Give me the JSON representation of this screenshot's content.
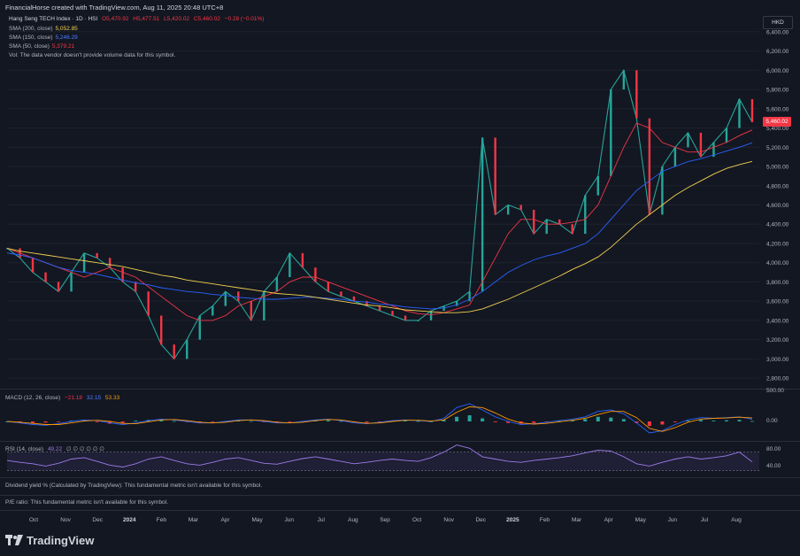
{
  "header": {
    "attribution": "FinancialHorse created with TradingView.com, Aug 11, 2025 20:48 UTC+8"
  },
  "legend": {
    "symbol": "Hang Seng TECH Index · 1D · HSI",
    "ohlc": {
      "o": "O5,470.92",
      "h": "H5,477.51",
      "l": "L5,420.02",
      "c": "C5,460.02",
      "chg": "−0.28 (−0.01%)"
    },
    "sma200": {
      "label": "SMA (200, close)",
      "value": "5,052.85",
      "color": "#f0d050"
    },
    "sma150": {
      "label": "SMA (150, close)",
      "value": "5,246.29",
      "color": "#2962ff"
    },
    "sma50": {
      "label": "SMA (50, close)",
      "value": "5,379.21",
      "color": "#f23645"
    },
    "vol": "Vol: The data vendor doesn't provide volume data for this symbol."
  },
  "currency_button": "HKD",
  "last_price_tag": "5,460.02",
  "macd_panel": {
    "label": "MACD (12, 26, close)",
    "v1": "−21.18",
    "v2": "32.15",
    "v3": "53.33",
    "axis": [
      "500.00",
      "0.00"
    ]
  },
  "rsi_panel": {
    "label": "RSI (14, close)",
    "value": "49.22",
    "extra": "∅ ∅ ∅ ∅ ∅ ∅",
    "axis": [
      "80.00",
      "40.00"
    ]
  },
  "dividend_panel": "Dividend yield % (Calculated by TradingView): This fundamental metric isn't available for this symbol.",
  "pe_panel": "P/E ratio: This fundamental metric isn't available for this symbol.",
  "brand": "TradingView",
  "chart_data": {
    "type": "line",
    "title": "Hang Seng TECH Index · 1D · HSI",
    "ylim": [
      2700,
      6500
    ],
    "y_ticks": [
      "6,400.00",
      "6,200.00",
      "6,000.00",
      "5,800.00",
      "5,600.00",
      "5,400.00",
      "5,200.00",
      "5,000.00",
      "4,800.00",
      "4,600.00",
      "4,400.00",
      "4,200.00",
      "4,000.00",
      "3,800.00",
      "3,600.00",
      "3,400.00",
      "3,200.00",
      "3,000.00",
      "2,800.00"
    ],
    "x_ticks": [
      "Oct",
      "Nov",
      "Dec",
      "2024",
      "Feb",
      "Mar",
      "Apr",
      "May",
      "Jun",
      "Jul",
      "Aug",
      "Sep",
      "Oct",
      "Nov",
      "Dec",
      "2025",
      "Feb",
      "Mar",
      "Apr",
      "May",
      "Jun",
      "Jul",
      "Aug"
    ],
    "series": [
      {
        "name": "Hang Seng TECH Index",
        "color": "#26a69a",
        "values": [
          4150,
          4050,
          3900,
          3800,
          3700,
          3900,
          4100,
          4050,
          3950,
          3800,
          3700,
          3450,
          3150,
          3000,
          3200,
          3450,
          3550,
          3700,
          3600,
          3400,
          3700,
          3850,
          4100,
          3950,
          3800,
          3700,
          3650,
          3600,
          3550,
          3500,
          3450,
          3400,
          3400,
          3500,
          3550,
          3600,
          3700,
          5300,
          4500,
          4600,
          4550,
          4300,
          4450,
          4400,
          4300,
          4700,
          4900,
          5800,
          6000,
          5500,
          4500,
          5000,
          5200,
          5350,
          5100,
          5250,
          5400,
          5700,
          5460
        ]
      },
      {
        "name": "SMA (50, close)",
        "color": "#f23645",
        "values": [
          4150,
          4100,
          4050,
          4000,
          3950,
          3900,
          3850,
          3900,
          3950,
          3900,
          3850,
          3750,
          3650,
          3550,
          3450,
          3400,
          3400,
          3450,
          3550,
          3600,
          3650,
          3700,
          3800,
          3850,
          3850,
          3800,
          3750,
          3700,
          3650,
          3600,
          3550,
          3500,
          3470,
          3460,
          3480,
          3520,
          3560,
          3800,
          4050,
          4300,
          4450,
          4450,
          4400,
          4400,
          4420,
          4450,
          4600,
          4900,
          5200,
          5450,
          5400,
          5250,
          5200,
          5150,
          5150,
          5200,
          5250,
          5320,
          5379
        ]
      },
      {
        "name": "SMA (150, close)",
        "color": "#2962ff",
        "values": [
          4100,
          4080,
          4050,
          4000,
          3950,
          3920,
          3900,
          3880,
          3850,
          3820,
          3790,
          3770,
          3740,
          3720,
          3700,
          3690,
          3670,
          3660,
          3640,
          3630,
          3620,
          3620,
          3630,
          3640,
          3640,
          3630,
          3620,
          3600,
          3590,
          3570,
          3560,
          3540,
          3530,
          3520,
          3530,
          3560,
          3620,
          3700,
          3800,
          3900,
          3970,
          4030,
          4070,
          4100,
          4150,
          4200,
          4300,
          4450,
          4600,
          4750,
          4850,
          4950,
          5000,
          5050,
          5080,
          5120,
          5160,
          5200,
          5246
        ]
      },
      {
        "name": "SMA (200, close)",
        "color": "#f0d050",
        "values": [
          4150,
          4120,
          4100,
          4080,
          4060,
          4040,
          4020,
          4000,
          3980,
          3960,
          3930,
          3900,
          3870,
          3850,
          3820,
          3800,
          3780,
          3760,
          3740,
          3720,
          3700,
          3680,
          3670,
          3660,
          3640,
          3620,
          3600,
          3580,
          3560,
          3550,
          3530,
          3510,
          3500,
          3490,
          3480,
          3480,
          3490,
          3520,
          3570,
          3620,
          3680,
          3740,
          3800,
          3860,
          3930,
          3990,
          4060,
          4160,
          4280,
          4400,
          4500,
          4600,
          4700,
          4780,
          4850,
          4920,
          4980,
          5020,
          5053
        ]
      }
    ],
    "macd": {
      "hist": [
        0,
        -10,
        -20,
        -15,
        -5,
        10,
        15,
        -10,
        -30,
        -20,
        10,
        20,
        15,
        5,
        -5,
        -10,
        -5,
        5,
        10,
        5,
        -5,
        -10,
        -5,
        5,
        10,
        15,
        5,
        -10,
        -15,
        -5,
        5,
        10,
        5,
        0,
        20,
        60,
        80,
        40,
        -10,
        -20,
        -30,
        -20,
        -10,
        5,
        15,
        30,
        60,
        50,
        30,
        -20,
        -60,
        -40,
        -10,
        10,
        20,
        10,
        15,
        20,
        5
      ],
      "macd_line": [
        0,
        -20,
        -40,
        -50,
        -30,
        0,
        20,
        10,
        -20,
        -40,
        -20,
        10,
        30,
        20,
        0,
        -20,
        -20,
        0,
        20,
        20,
        0,
        -20,
        -20,
        0,
        20,
        30,
        10,
        -20,
        -30,
        -10,
        10,
        20,
        10,
        0,
        40,
        180,
        230,
        150,
        60,
        0,
        -40,
        -30,
        -10,
        10,
        30,
        60,
        130,
        150,
        100,
        -20,
        -150,
        -120,
        -40,
        20,
        50,
        40,
        50,
        60,
        30
      ],
      "signal_line": [
        0,
        -10,
        -25,
        -40,
        -40,
        -20,
        5,
        15,
        0,
        -25,
        -30,
        -5,
        20,
        25,
        10,
        -10,
        -20,
        -10,
        10,
        20,
        10,
        -10,
        -20,
        -10,
        10,
        25,
        20,
        -5,
        -25,
        -20,
        0,
        15,
        15,
        5,
        20,
        120,
        190,
        180,
        110,
        30,
        -20,
        -35,
        -25,
        -5,
        15,
        40,
        90,
        130,
        130,
        50,
        -90,
        -130,
        -80,
        -10,
        30,
        40,
        45,
        55,
        45
      ]
    },
    "rsi": {
      "values": [
        52,
        48,
        45,
        40,
        46,
        55,
        58,
        50,
        42,
        38,
        45,
        55,
        60,
        52,
        45,
        42,
        48,
        55,
        58,
        52,
        46,
        44,
        50,
        56,
        60,
        55,
        50,
        45,
        48,
        52,
        55,
        52,
        50,
        58,
        70,
        85,
        78,
        60,
        55,
        50,
        48,
        52,
        55,
        58,
        62,
        68,
        74,
        72,
        60,
        45,
        40,
        48,
        55,
        60,
        55,
        58,
        62,
        70,
        49
      ],
      "levels": [
        70,
        30
      ],
      "range": [
        20,
        90
      ]
    }
  }
}
